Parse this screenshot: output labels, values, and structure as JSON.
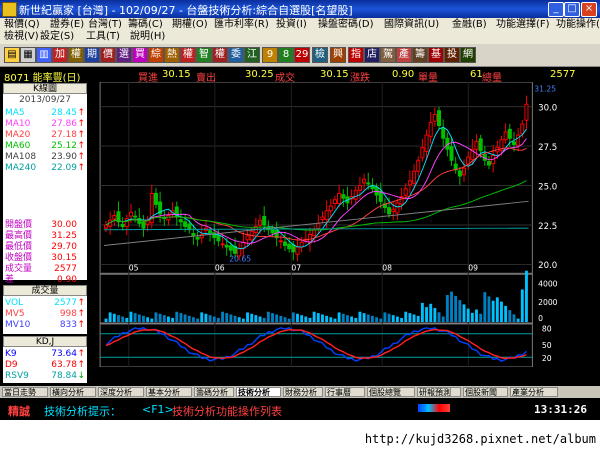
{
  "window": {
    "title": "新世紀贏家 [台灣] - 102/09/27 - 台盤技術分析:綜合自選股[名望股]"
  },
  "menu": [
    "報價(Q)",
    "證券(E)",
    "台灣(T)",
    "籌碼(C)",
    "期權(O)",
    "匯市利率(R)",
    "投資(I)",
    "操盤密碼(D)",
    "國際資訊(U)",
    "金融(B)",
    "功能選擇(F)",
    "功能操作(E)",
    "檢視(V)",
    "設定(S)",
    "工具(T)",
    "說明(H)"
  ],
  "toolbar": [
    "加",
    "權",
    "期",
    "價",
    "選",
    "買",
    "綜",
    "熱",
    "權",
    "智",
    "權",
    "委",
    "江",
    "9",
    "8",
    "29",
    "檢",
    "興",
    "指",
    "店",
    "駕",
    "產",
    "籌",
    "基",
    "投",
    "網"
  ],
  "quote": {
    "code_name": "8071 能率豐(日)",
    "buy_label": "買進",
    "buy": "30.15",
    "sell_label": "賣出",
    "sell": "30.25",
    "deal_label": "成交",
    "deal": "30.15",
    "chg_label": "漲跌",
    "chg": "0.90",
    "vol_label": "單量",
    "vol": "61",
    "tvol_label": "總量",
    "tvol": "2577"
  },
  "kline_panel": {
    "header": "K線圖",
    "date": "2013/09/27",
    "ma": [
      {
        "name": "MA5",
        "value": "28.45",
        "arrow": "↑",
        "color": "#00e0ff"
      },
      {
        "name": "MA10",
        "value": "27.86",
        "arrow": "↑",
        "color": "#ff40ff"
      },
      {
        "name": "MA20",
        "value": "27.18",
        "arrow": "↑",
        "color": "#ff4040"
      },
      {
        "name": "MA60",
        "value": "25.12",
        "arrow": "↑",
        "color": "#00c000"
      },
      {
        "name": "MA108",
        "value": "23.90",
        "arrow": "↑",
        "color": "#404040"
      },
      {
        "name": "MA240",
        "value": "22.09",
        "arrow": "↑",
        "color": "#00a0a0"
      }
    ],
    "prices": [
      {
        "name": "開盤價",
        "value": "30.00"
      },
      {
        "name": "最高價",
        "value": "31.25"
      },
      {
        "name": "最低價",
        "value": "29.70"
      },
      {
        "name": "收盤價",
        "value": "30.15"
      },
      {
        "name": "成交量",
        "value": "2577"
      },
      {
        "name": "差",
        "value": "0.90"
      }
    ]
  },
  "volume_panel": {
    "header": "成交量",
    "rows": [
      {
        "name": "VOL",
        "value": "2577",
        "arrow": "↑",
        "color": "#00e0ff"
      },
      {
        "name": "MV5",
        "value": "998",
        "arrow": "↑",
        "color": "#ff4040"
      },
      {
        "name": "MV10",
        "value": "833",
        "arrow": "↑",
        "color": "#4040ff"
      }
    ]
  },
  "kd_panel": {
    "header": "KD,J",
    "rows": [
      {
        "name": "K9",
        "value": "73.64",
        "arrow": "↑",
        "color": "#0000ff"
      },
      {
        "name": "D9",
        "value": "63.78",
        "arrow": "↑",
        "color": "#ff0000"
      },
      {
        "name": "RSV9",
        "value": "78.84",
        "arrow": "↓",
        "color": "#00a0a0"
      }
    ]
  },
  "chart": {
    "price_ticks": [
      "30.0",
      "27.5",
      "25.0",
      "22.5",
      "20.0"
    ],
    "price_max_label": "31.25",
    "price_min_label": "20.65",
    "months": [
      "05",
      "06",
      "07",
      "08",
      "09"
    ],
    "vol_ticks": [
      "4000",
      "2000",
      "0"
    ],
    "kd_ticks": [
      "80",
      "50",
      "20"
    ]
  },
  "chart_data": {
    "type": "candlestick",
    "title": "8071 能率豐(日)",
    "ylim": [
      19.5,
      31.5
    ],
    "x_months": [
      "05",
      "06",
      "07",
      "08",
      "09"
    ],
    "close_series": [
      22.5,
      22.8,
      23.1,
      22.7,
      22.4,
      22.9,
      23.3,
      23.0,
      22.6,
      22.3,
      22.8,
      24.5,
      23.8,
      23.2,
      22.9,
      23.1,
      23.4,
      23.0,
      22.7,
      22.4,
      22.2,
      21.8,
      21.6,
      21.9,
      22.3,
      22.0,
      21.7,
      21.5,
      21.3,
      21.1,
      20.9,
      20.7,
      21.0,
      21.4,
      21.8,
      22.1,
      22.4,
      22.8,
      22.5,
      22.2,
      22.0,
      21.7,
      21.5,
      21.2,
      21.0,
      20.8,
      21.1,
      21.4,
      21.6,
      21.9,
      22.2,
      22.6,
      23.0,
      23.4,
      23.7,
      24.1,
      24.5,
      24.2,
      23.9,
      24.3,
      24.7,
      25.0,
      25.4,
      25.1,
      24.8,
      24.4,
      24.0,
      23.6,
      23.2,
      23.5,
      23.9,
      24.3,
      24.8,
      25.3,
      25.9,
      26.6,
      27.4,
      28.2,
      29.0,
      29.5,
      28.8,
      28.0,
      27.3,
      26.6,
      26.0,
      25.6,
      26.1,
      26.8,
      27.3,
      27.8,
      27.2,
      26.6,
      26.3,
      26.9,
      27.4,
      27.9,
      28.4,
      28.0,
      27.6,
      28.2,
      28.9,
      30.15
    ],
    "volume_max": 4000,
    "kd_range": [
      0,
      100
    ]
  },
  "bottom_tabs": [
    "當日走勢",
    "橫向分析",
    "深度分析",
    "基本分析",
    "籌碼分析",
    "技術分析",
    "財務分析",
    "行事曆",
    "個股總覽",
    "研報預測",
    "個股新聞",
    "產業分析"
  ],
  "hint": {
    "left": "精誠",
    "mid": "技術分析提示：",
    "key": "<F1>",
    "text": "技術分析功能操作列表",
    "time": "13:31:26"
  },
  "url": "http://kujd3268.pixnet.net/album",
  "colors": {
    "up": "#ff0000",
    "down": "#00c000",
    "bg": "#000000",
    "panel_bg": "#ffffff"
  }
}
